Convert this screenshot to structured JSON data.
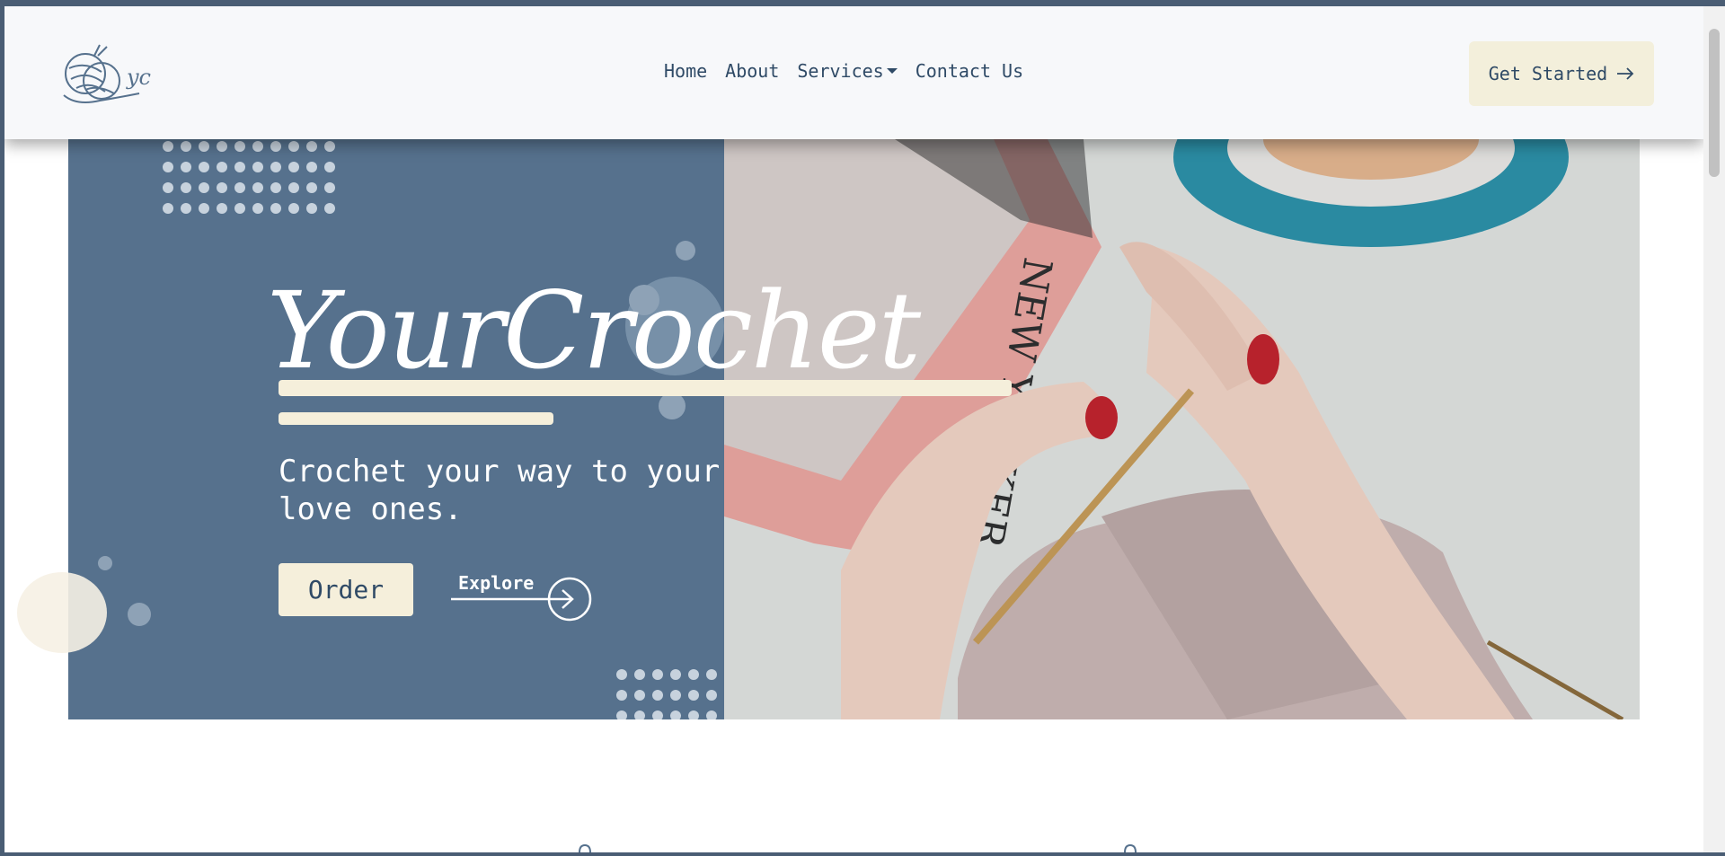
{
  "navbar": {
    "logo_alt": "YC",
    "links": [
      {
        "label": "Home"
      },
      {
        "label": "About"
      },
      {
        "label": "Services"
      },
      {
        "label": "Contact Us"
      }
    ],
    "cta_label": "Get Started",
    "cta_icon": "arrow-right-icon"
  },
  "hero": {
    "title": "YourCrochet",
    "tagline": "Crochet your way to your love ones.",
    "order_label": "Order",
    "explore_label": "Explore",
    "image_description_icon": "crochet-hands-image"
  },
  "colors": {
    "primary": "#56718d",
    "accent": "#f5efdb",
    "text": "#2f4a66"
  }
}
